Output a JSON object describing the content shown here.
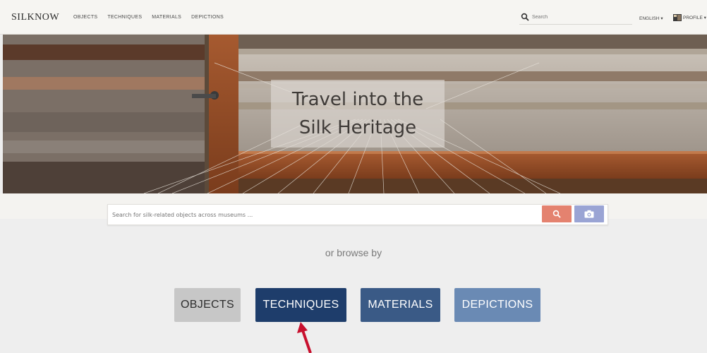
{
  "header": {
    "logo": "SILKNOW",
    "nav": [
      "OBJECTS",
      "TECHNIQUES",
      "MATERIALS",
      "DEPICTIONS"
    ],
    "search_placeholder": "Search",
    "language": "ENGLISH ▾",
    "profile": "PROFILE ▾"
  },
  "hero": {
    "line1": "Travel into the",
    "line2": "Silk Heritage"
  },
  "search": {
    "placeholder": "Search for silk-related objects across museums ..."
  },
  "browse": {
    "label": "or browse by",
    "buttons": [
      "OBJECTS",
      "TECHNIQUES",
      "MATERIALS",
      "DEPICTIONS"
    ]
  },
  "colors": {
    "search_button": "#e4826f",
    "camera_button": "#9aa4d4",
    "techniques": "#1e3d6b",
    "materials": "#3a5a86",
    "depictions": "#6a8ab4",
    "objects": "#c7c7c7",
    "annotation_arrow": "#c8102e"
  },
  "icons": [
    "search-icon",
    "profile-icon",
    "camera-icon",
    "annotation-arrow"
  ]
}
